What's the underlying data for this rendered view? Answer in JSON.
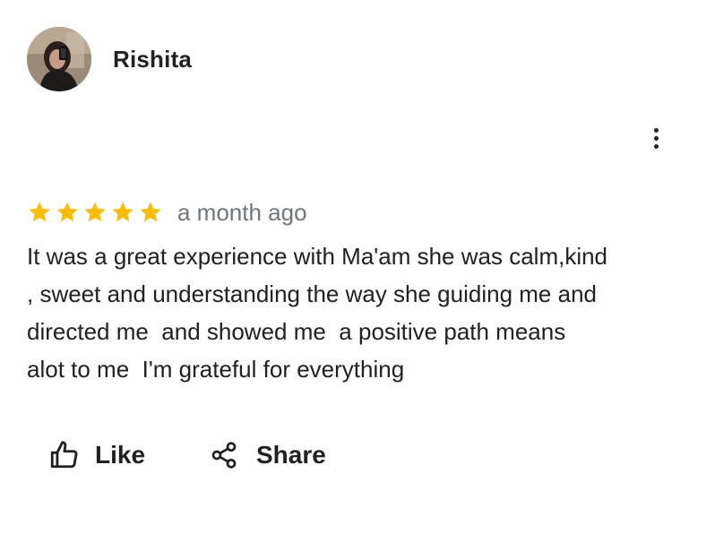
{
  "review": {
    "reviewer_name": "Rishita",
    "rating": 5,
    "rating_max": 5,
    "time_ago": "a month ago",
    "text": "It was a great experience with Ma'am she was calm,kind\n, sweet and understanding the way she guiding me and\ndirected me  and showed me  a positive path means\nalot to me  I'm grateful for everything"
  },
  "actions": {
    "like_label": "Like",
    "share_label": "Share"
  },
  "colors": {
    "star": "#fbbc04",
    "text": "#202124",
    "secondary_text": "#70757a"
  },
  "icons": {
    "avatar": "profile-photo",
    "more": "more-vert-icon",
    "star": "star-icon",
    "like": "thumb-up-icon",
    "share": "share-icon"
  }
}
